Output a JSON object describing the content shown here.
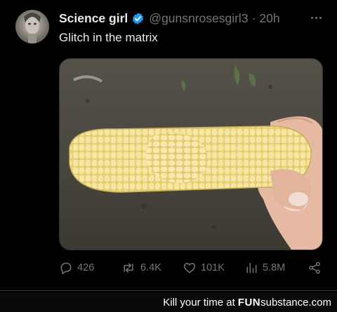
{
  "tweet": {
    "display_name": "Science girl",
    "handle": "@gunsnrosesgirl3",
    "separator": "·",
    "time": "20h",
    "text": "Glitch in the matrix",
    "media_icon": "corn-photo"
  },
  "actions": {
    "replies": "426",
    "reposts": "6.4K",
    "likes": "101K",
    "views": "5.8M"
  },
  "footer": {
    "tagline": "Kill your time at",
    "brand_fun": "FUN",
    "brand_rest": "substance.com"
  },
  "colors": {
    "background": "#000000",
    "text": "#e7e9ea",
    "muted": "#71767b",
    "verified": "#1d9bf0",
    "corn": "#f3e08a"
  }
}
